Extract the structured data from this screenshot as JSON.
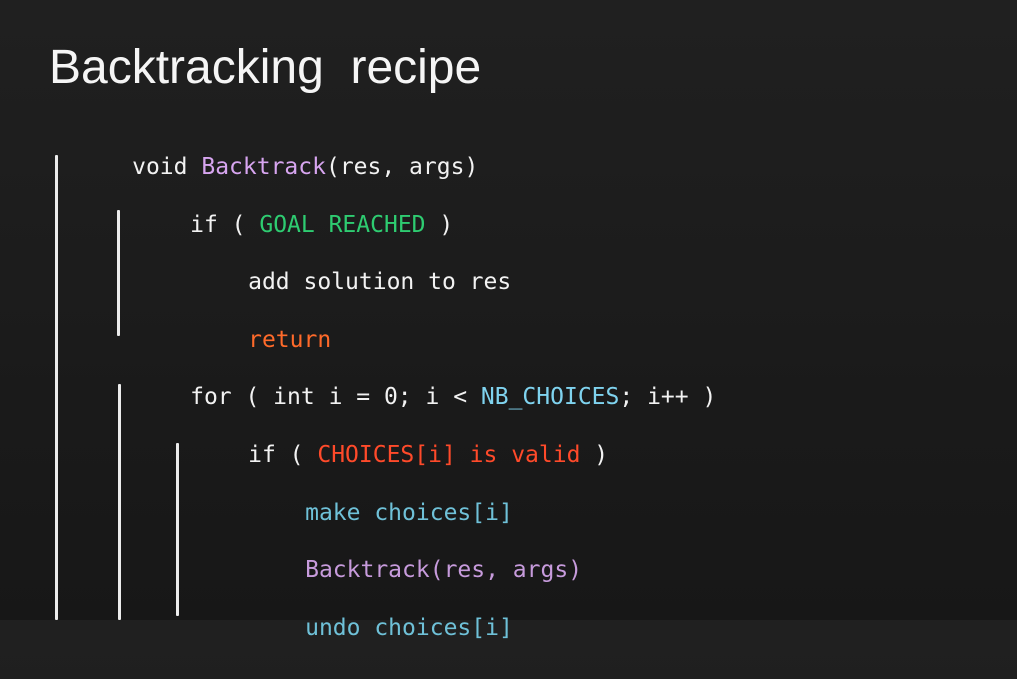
{
  "slide": {
    "title": "Backtracking  recipe",
    "colors": {
      "background": "#1c1c1c",
      "text": "#f2f2f2",
      "function": "#d7a5f0",
      "goal": "#2ecc71",
      "return": "#ff6a2a",
      "constant": "#7fd3ef",
      "condition": "#ff4a2a",
      "action": "#6fc1d8",
      "call": "#c79bdc"
    },
    "code": {
      "l1": {
        "kw": "void ",
        "fn": "Backtrack",
        "rest": "(res, args)"
      },
      "l2": {
        "kw": "if ( ",
        "cond": "GOAL REACHED",
        "end": " )"
      },
      "l3": {
        "text": "add solution to res"
      },
      "l4": {
        "text": "return"
      },
      "l5": {
        "kw": "for ( int i = 0; i < ",
        "const": "NB_CHOICES",
        "end": "; i++ )"
      },
      "l6": {
        "kw": "if ( ",
        "cond": "CHOICES[i] is valid",
        "end": " )"
      },
      "l7": {
        "text": "make choices[i]"
      },
      "l8": {
        "text": "Backtrack(res, args)"
      },
      "l9": {
        "text": "undo choices[i]"
      }
    }
  }
}
